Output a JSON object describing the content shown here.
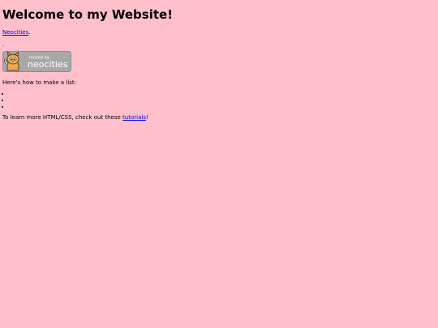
{
  "page": {
    "background_color": "#ffc0cb",
    "link_color": "#0000ee"
  },
  "heading": "Welcome to my Website!",
  "intro": {
    "link_text": "Neocities",
    "after_link": "."
  },
  "stray_text": ".",
  "badge": {
    "icon": "neocities-cat-logo-icon",
    "line1": "hosted by",
    "line2": "neocities"
  },
  "list_intro": "Here's how to make a list:",
  "list_items": [
    "",
    "",
    ""
  ],
  "learn_more": {
    "before_link": "To learn more HTML/CSS, check out these ",
    "link_text": "tutorials",
    "after_link": "!"
  }
}
